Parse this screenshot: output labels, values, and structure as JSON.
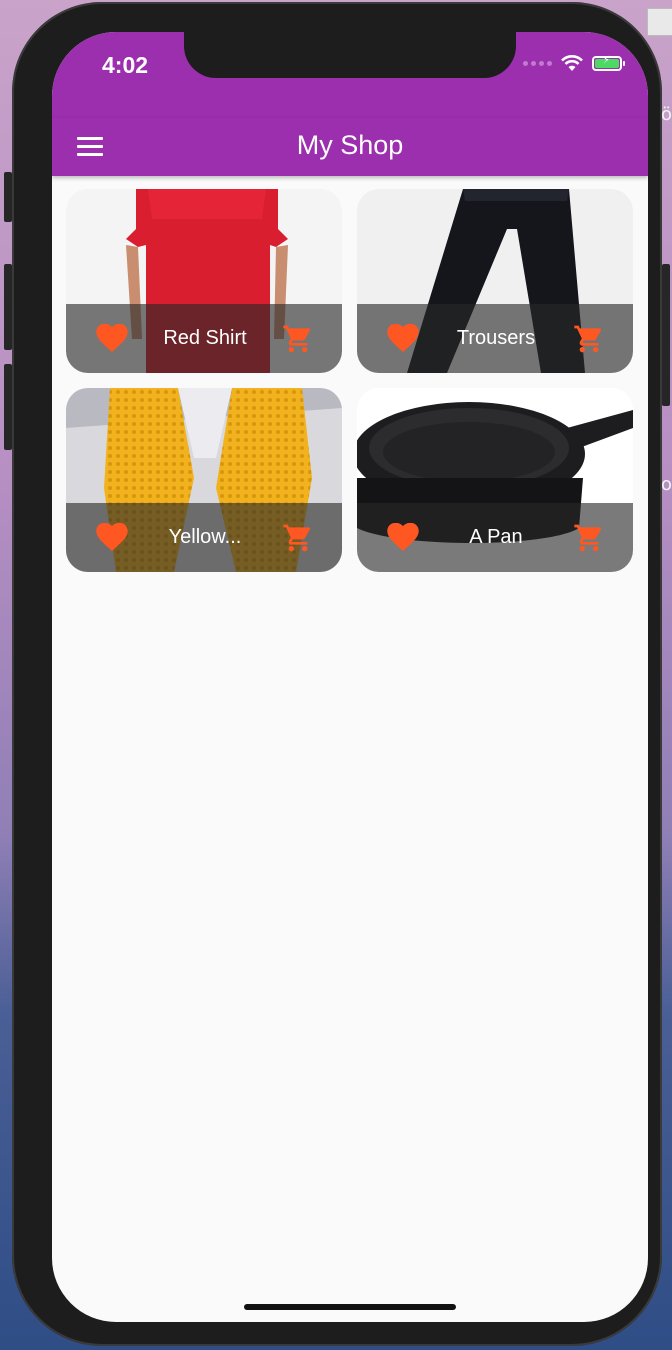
{
  "status_bar": {
    "time": "4:02"
  },
  "app_bar": {
    "title": "My Shop"
  },
  "products": [
    {
      "name": "Red Shirt"
    },
    {
      "name": "Trousers"
    },
    {
      "name": "Yellow..."
    },
    {
      "name": "A Pan"
    }
  ],
  "colors": {
    "app_bar": "#9b2fae",
    "accent": "#ff5722",
    "tile_footer": "#282828"
  }
}
